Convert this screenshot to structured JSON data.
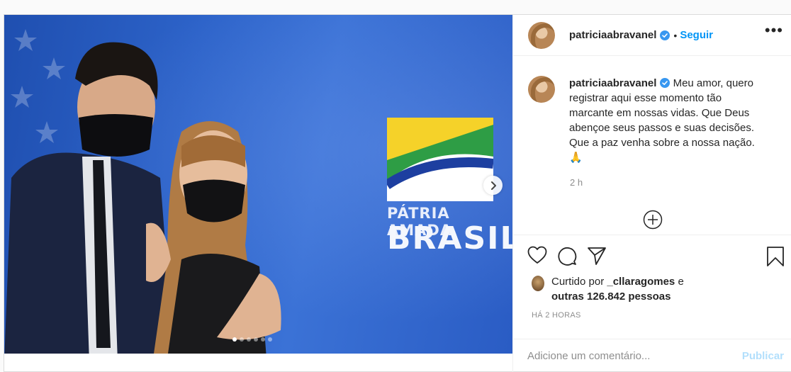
{
  "post": {
    "username": "patriciaabravanel",
    "verified": true,
    "follow_label": "Seguir",
    "separator": "•",
    "more_label": "•••",
    "caption": "Meu amor, quero registrar aqui esse momento tão marcante em nossas vidas. Que Deus abençoe seus passos e suas decisões. Que a paz venha sobre a nossa nação. 🙏",
    "relative_time": "2 h",
    "timestamp": "HÁ 2 HORAS",
    "likes": {
      "prefix": "Curtido por",
      "liked_by": "_cllaragomes",
      "connector": "e",
      "others": "outras 126.842 pessoas"
    },
    "carousel": {
      "total": 6,
      "active_index": 0
    },
    "photo": {
      "logo_line1": "PÁTRIA AMADA",
      "logo_line2": "BRASIL"
    }
  },
  "comment_box": {
    "placeholder": "Adicione um comentário...",
    "publish_label": "Publicar"
  },
  "colors": {
    "accent": "#0095f6",
    "publish_disabled": "#b2dffc",
    "verified": "#3897f0"
  },
  "icons": [
    "chevron-right-icon",
    "verified-icon",
    "more-icon",
    "add-circle-icon",
    "heart-icon",
    "comment-icon",
    "share-icon",
    "bookmark-icon"
  ]
}
